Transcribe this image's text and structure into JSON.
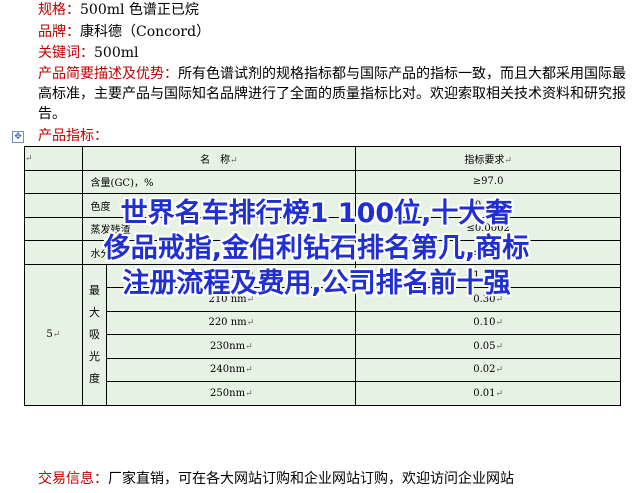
{
  "spec": {
    "label": "规格：",
    "value": "500ml 色谱正已烷"
  },
  "brand": {
    "label": "品牌：",
    "value": "康科德（Concord）"
  },
  "keyword": {
    "label": "关键词：",
    "value": "500ml"
  },
  "desc": {
    "label": "产品简要描述及优势：",
    "text": "所有色谱试剂的规格指标都与国际产品的指标一致，而且大都采用国际最高标准，主要产品与国际知名品牌进行了全面的质量指标比对。欢迎索取相关技术资料和研究报告。"
  },
  "indicators": {
    "label": "产品指标："
  },
  "anchor_glyph": "✥",
  "return_mark": "↵",
  "table": {
    "header_name": "名　称",
    "header_req": "指标要求",
    "rows": [
      {
        "name": "含量(GC)，%",
        "req": "≥97.0"
      },
      {
        "name": "色度",
        "req": "≤0.0010"
      },
      {
        "name": "蒸发残渣",
        "req": "≤0.0002"
      },
      {
        "name": "水分",
        "req": "≤0.01"
      }
    ],
    "abs_index": "5",
    "abs_label_chars": [
      "最",
      "大",
      "吸",
      "光",
      "度"
    ],
    "abs_rows": [
      {
        "wl": "195 nm",
        "val": "1.00"
      },
      {
        "wl": "210 nm",
        "val": "0.30"
      },
      {
        "wl": "220 nm",
        "val": "0.10"
      },
      {
        "wl": "230nm",
        "val": "0.05"
      },
      {
        "wl": "240nm",
        "val": "0.02"
      },
      {
        "wl": "250nm",
        "val": "0.01"
      }
    ]
  },
  "overlay": {
    "line1": "世界名车排行榜1 100位,十大奢",
    "line2": "侈品戒指,金伯利钻石排名第几,商标",
    "line3": "注册流程及费用,公司排名前十强"
  },
  "footer": {
    "label": "交易信息：",
    "text": "厂家直销，可在各大网站订购和企业网站订购，欢迎访问企业网站"
  }
}
